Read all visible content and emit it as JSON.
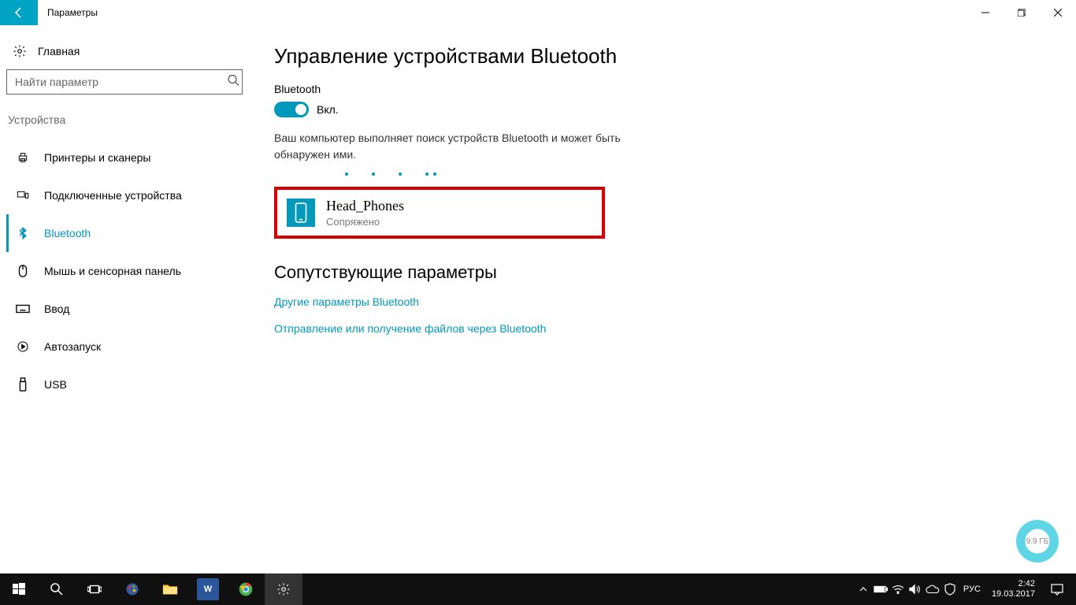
{
  "window": {
    "title": "Параметры"
  },
  "sidebar": {
    "home": "Главная",
    "search_placeholder": "Найти параметр",
    "category": "Устройства",
    "items": [
      {
        "label": "Принтеры и сканеры"
      },
      {
        "label": "Подключенные устройства"
      },
      {
        "label": "Bluetooth"
      },
      {
        "label": "Мышь и сенсорная панель"
      },
      {
        "label": "Ввод"
      },
      {
        "label": "Автозапуск"
      },
      {
        "label": "USB"
      }
    ]
  },
  "main": {
    "title": "Управление устройствами Bluetooth",
    "bt_label": "Bluetooth",
    "toggle_state": "Вкл.",
    "status": "Ваш компьютер выполняет поиск устройств Bluetooth и может быть обнаружен ими.",
    "device": {
      "name": "Head_Phones",
      "status": "Сопряжено"
    },
    "related_title": "Сопутствующие параметры",
    "links": [
      "Другие параметры Bluetooth",
      "Отправление или получение файлов через Bluetooth"
    ]
  },
  "widget": {
    "text": "9.9 ГБ"
  },
  "taskbar": {
    "lang": "РУС",
    "time": "2:42",
    "date": "19.03.2017"
  }
}
